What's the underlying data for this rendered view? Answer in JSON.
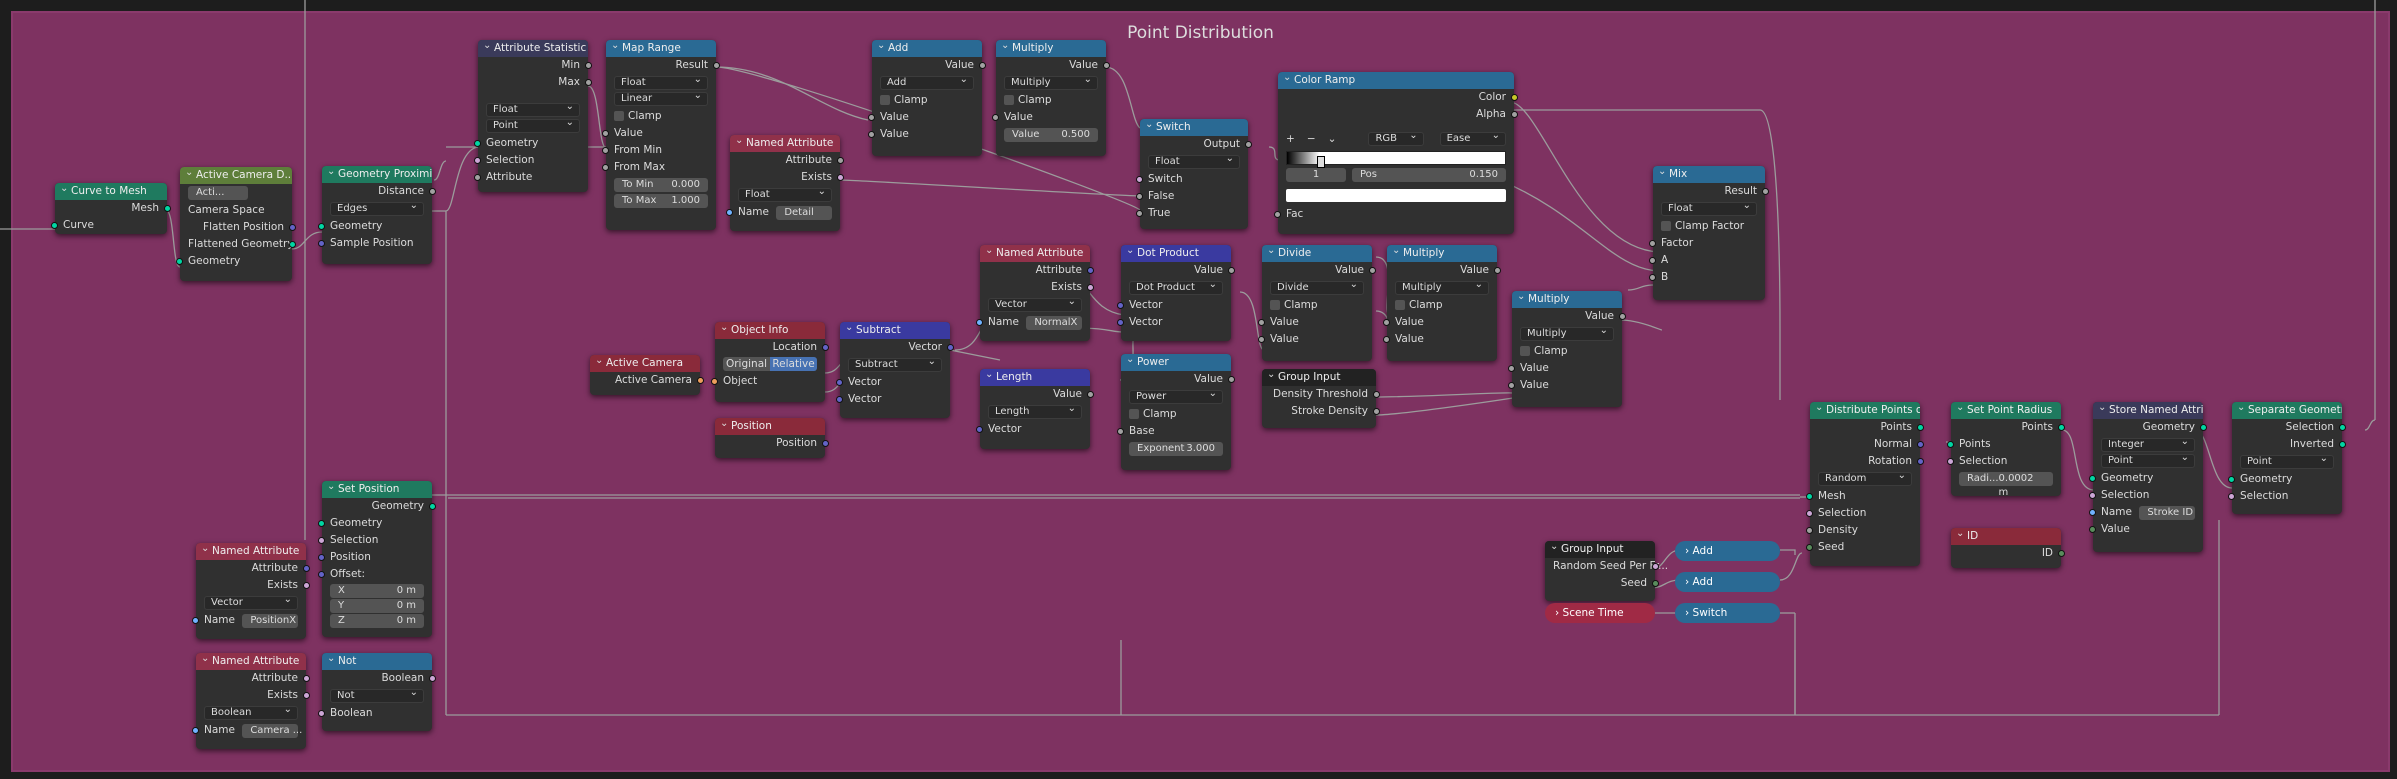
{
  "frame": {
    "title": "Point Distribution"
  },
  "nodes": {
    "curve_to_mesh": {
      "title": "Curve to Mesh",
      "out": "Mesh",
      "in": "Curve"
    },
    "active_cam_d": {
      "title": "Active Camera D...",
      "mode": "Acti...",
      "camera_space": "Camera Space",
      "out1": "Flatten Position",
      "out2": "Flattened Geometry",
      "in": "Geometry"
    },
    "geo_prox": {
      "title": "Geometry Proximity",
      "out": "Distance",
      "mode": "Edges",
      "in1": "Geometry",
      "in2": "Sample Position"
    },
    "attr_stat": {
      "title": "Attribute Statistic",
      "out1": "Min",
      "out2": "Max",
      "type": "Float",
      "domain": "Point",
      "in1": "Geometry",
      "in2": "Selection",
      "in3": "Attribute"
    },
    "map_range": {
      "title": "Map Range",
      "out": "Result",
      "type": "Float",
      "interp": "Linear",
      "clamp": "Clamp",
      "in1": "Value",
      "in2": "From Min",
      "in3": "From Max",
      "to_min_l": "To Min",
      "to_min_v": "0.000",
      "to_max_l": "To Max",
      "to_max_v": "1.000"
    },
    "named_attr1": {
      "title": "Named Attribute",
      "out1": "Attribute",
      "out2": "Exists",
      "type": "Float",
      "name_l": "Name",
      "name_v": "Detail"
    },
    "add1": {
      "title": "Add",
      "out": "Value",
      "op": "Add",
      "clamp": "Clamp",
      "in1": "Value",
      "in2": "Value"
    },
    "mult1": {
      "title": "Multiply",
      "out": "Value",
      "op": "Multiply",
      "clamp": "Clamp",
      "in1": "Value",
      "val_l": "Value",
      "val_v": "0.500"
    },
    "switch1": {
      "title": "Switch",
      "out": "Output",
      "type": "Float",
      "in1": "Switch",
      "in2": "False",
      "in3": "True"
    },
    "color_ramp": {
      "title": "Color Ramp",
      "out1": "Color",
      "out2": "Alpha",
      "plus": "+",
      "minus": "−",
      "chev": "⌄",
      "mode": "RGB",
      "interp": "Ease",
      "stop_idx": "1",
      "pos_l": "Pos",
      "pos_v": "0.150",
      "in": "Fac"
    },
    "mix": {
      "title": "Mix",
      "out": "Result",
      "type": "Float",
      "clamp": "Clamp Factor",
      "in1": "Factor",
      "in2": "A",
      "in3": "B"
    },
    "named_attr2": {
      "title": "Named Attribute",
      "out1": "Attribute",
      "out2": "Exists",
      "type": "Vector",
      "name_l": "Name",
      "name_v": "NormalX"
    },
    "dot": {
      "title": "Dot Product",
      "out": "Value",
      "op": "Dot Product",
      "in1": "Vector",
      "in2": "Vector"
    },
    "divide": {
      "title": "Divide",
      "out": "Value",
      "op": "Divide",
      "clamp": "Clamp",
      "in1": "Value",
      "in2": "Value"
    },
    "mult2": {
      "title": "Multiply",
      "out": "Value",
      "op": "Multiply",
      "clamp": "Clamp",
      "in1": "Value",
      "in2": "Value"
    },
    "mult3": {
      "title": "Multiply",
      "out": "Value",
      "op": "Multiply",
      "clamp": "Clamp",
      "in1": "Value",
      "in2": "Value"
    },
    "obj_info": {
      "title": "Object Info",
      "out": "Location",
      "btn1": "Original",
      "btn2": "Relative",
      "in": "Object"
    },
    "subtract": {
      "title": "Subtract",
      "out": "Vector",
      "op": "Subtract",
      "in1": "Vector",
      "in2": "Vector"
    },
    "length": {
      "title": "Length",
      "out": "Value",
      "op": "Length",
      "in": "Vector"
    },
    "power": {
      "title": "Power",
      "out": "Value",
      "op": "Power",
      "clamp": "Clamp",
      "in1": "Base",
      "exp_l": "Exponent",
      "exp_v": "3.000"
    },
    "group_in1": {
      "title": "Group Input",
      "out1": "Density Threshold",
      "out2": "Stroke Density"
    },
    "active_camera": {
      "title": "Active Camera",
      "out": "Active Camera"
    },
    "position": {
      "title": "Position",
      "out": "Position"
    },
    "set_position": {
      "title": "Set Position",
      "out": "Geometry",
      "in1": "Geometry",
      "in2": "Selection",
      "in3": "Position",
      "in4": "Offset:",
      "x_l": "X",
      "x_v": "0 m",
      "y_l": "Y",
      "y_v": "0 m",
      "z_l": "Z",
      "z_v": "0 m"
    },
    "named_attr3": {
      "title": "Named Attribute",
      "out1": "Attribute",
      "out2": "Exists",
      "type": "Vector",
      "name_l": "Name",
      "name_v": "PositionX"
    },
    "named_attr4": {
      "title": "Named Attribute",
      "out1": "Attribute",
      "out2": "Exists",
      "type": "Boolean",
      "name_l": "Name",
      "name_v": "Camera ..."
    },
    "not": {
      "title": "Not",
      "out": "Boolean",
      "op": "Not",
      "in": "Boolean"
    },
    "distribute": {
      "title": "Distribute Points on ...",
      "out1": "Points",
      "out2": "Normal",
      "out3": "Rotation",
      "mode": "Random",
      "in1": "Mesh",
      "in2": "Selection",
      "in3": "Density",
      "in4": "Seed"
    },
    "set_radius": {
      "title": "Set Point Radius",
      "out": "Points",
      "in1": "Points",
      "in2": "Selection",
      "radius_l": "Radi...",
      "radius_v": "0.0002 m"
    },
    "id": {
      "title": "ID",
      "out": "ID"
    },
    "store_named": {
      "title": "Store Named Attrib...",
      "out": "Geometry",
      "type": "Integer",
      "domain": "Point",
      "in1": "Geometry",
      "in2": "Selection",
      "name_l": "Name",
      "name_v": "Stroke ID",
      "in3": "Value"
    },
    "separate": {
      "title": "Separate Geometry",
      "out1": "Selection",
      "out2": "Inverted",
      "domain": "Point",
      "in1": "Geometry",
      "in2": "Selection"
    },
    "group_in2": {
      "title": "Group Input",
      "out1": "Random Seed Per Fr...",
      "out2": "Seed"
    },
    "scene_time": {
      "title": "Scene Time"
    },
    "add_c1": {
      "title": "Add"
    },
    "add_c2": {
      "title": "Add"
    },
    "switch_c": {
      "title": "Switch"
    }
  },
  "colors": {
    "frame": "#7e3261",
    "wire": "#9c9c9c",
    "geometry_socket": "#00d6a3",
    "float_socket": "#a1a1a1",
    "vector_socket": "#6363c7"
  }
}
